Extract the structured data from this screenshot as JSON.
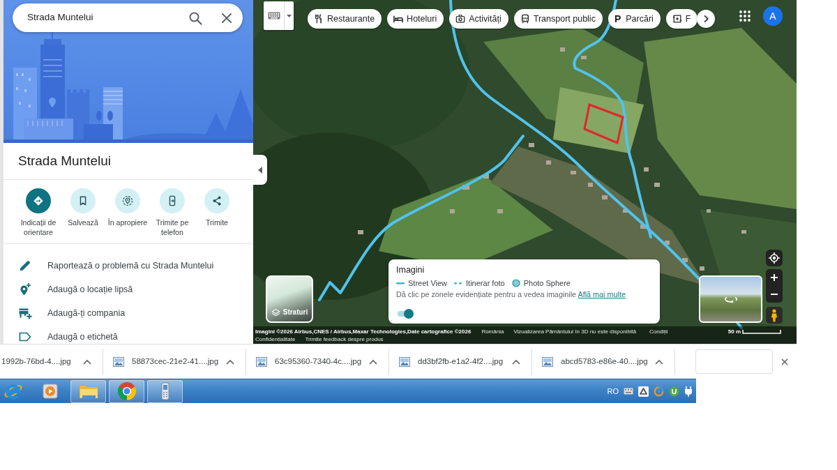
{
  "search": {
    "value": "Strada Muntelui"
  },
  "place": {
    "title": "Strada Muntelui"
  },
  "actions": [
    {
      "label": "Indicații de orientare",
      "primary": true
    },
    {
      "label": "Salvează",
      "primary": false
    },
    {
      "label": "În apropiere",
      "primary": false
    },
    {
      "label": "Trimite pe telefon",
      "primary": false
    },
    {
      "label": "Trimite",
      "primary": false
    }
  ],
  "menu_items": [
    {
      "label": "Raportează o problemă cu Strada Muntelui"
    },
    {
      "label": "Adaugă o locație lipsă"
    },
    {
      "label": "Adaugă-ți compania"
    },
    {
      "label": "Adaugă o etichetă"
    }
  ],
  "map": {
    "categories": [
      {
        "label": "Restaurante"
      },
      {
        "label": "Hoteluri"
      },
      {
        "label": "Activități"
      },
      {
        "label": "Transport public"
      },
      {
        "label": "Parcări",
        "symbol": "P"
      },
      {
        "label": "F"
      }
    ],
    "account": {
      "initial": "A"
    },
    "layers": {
      "label": "Straturi"
    },
    "imagery_panel": {
      "title": "Imagini",
      "legend": [
        {
          "kind": "line",
          "label": "Street View"
        },
        {
          "kind": "dashed",
          "label": "Itinerar foto"
        },
        {
          "kind": "dot",
          "label": "Photo Sphere"
        }
      ],
      "description": "Dă clic pe zonele evidențiate pentru a vedea imaginile",
      "link": "Află mai multe",
      "toggle_on": true
    },
    "attribution": {
      "credit": "Imagini ©2026 Airbus,CNES / Airbus,Maxar Technologies,Date cartografice ©2026",
      "country": "România",
      "notice": "Vizualizarea Pământului în 3D nu este disponibilă",
      "terms": "Condiții",
      "scale": "50 m",
      "privacy": "Confidențialitate",
      "feedback": "Trimite feedback despre produs"
    }
  },
  "downloads": [
    {
      "name": "1992b-76bd-4....jpg"
    },
    {
      "name": "58873cec-21e2-41....jpg"
    },
    {
      "name": "63c95360-7340-4c....jpg"
    },
    {
      "name": "dd3bf2fb-e1a2-4f2....jpg"
    },
    {
      "name": "abcd5783-e86e-40....jpg"
    }
  ],
  "taskbar": {
    "apps": [
      {
        "running": false
      },
      {
        "running": false
      },
      {
        "running": true
      },
      {
        "running": true
      },
      {
        "running": true
      }
    ],
    "language": "RO"
  }
}
